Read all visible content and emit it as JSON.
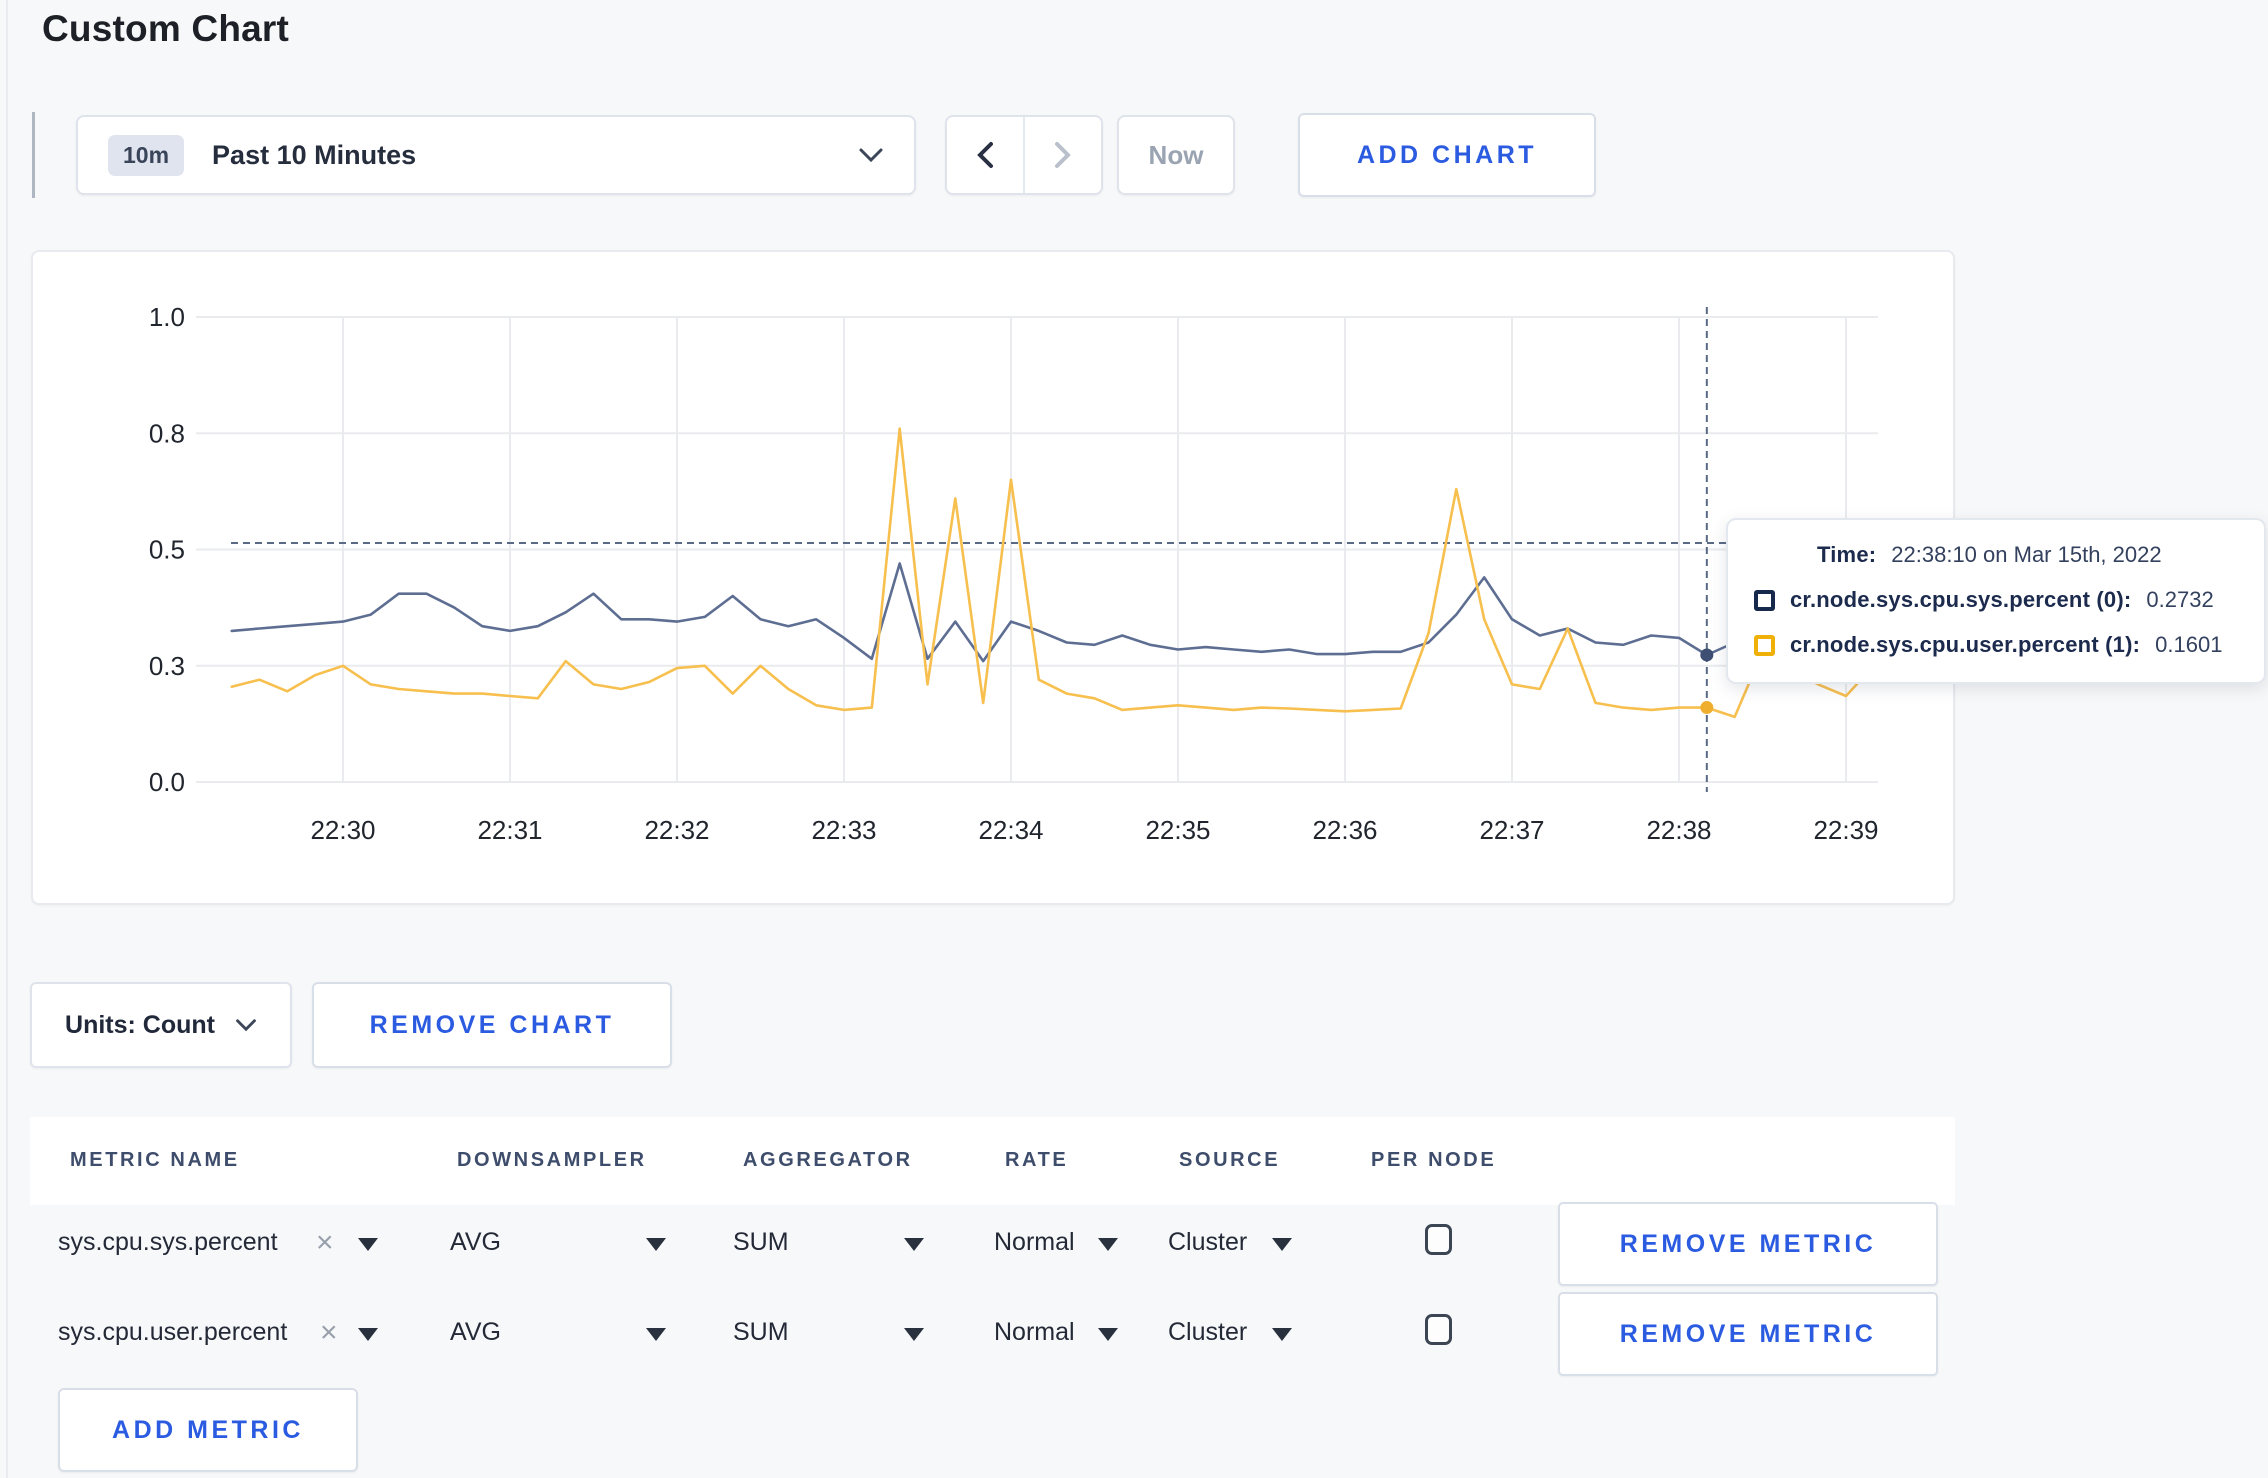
{
  "page": {
    "title": "Custom Chart"
  },
  "toolbar": {
    "time_badge": "10m",
    "time_label": "Past 10 Minutes",
    "now_label": "Now",
    "add_chart_label": "ADD CHART"
  },
  "chart_tooltip": {
    "time_label": "Time:",
    "time_value": "22:38:10 on Mar 15th, 2022",
    "series": [
      {
        "label": "cr.node.sys.cpu.sys.percent (0):",
        "value": "0.2732",
        "swatch_color": "#16294c"
      },
      {
        "label": "cr.node.sys.cpu.user.percent (1):",
        "value": "0.1601",
        "swatch_color": "#efb008"
      }
    ]
  },
  "chart_controls": {
    "units_label": "Units: Count",
    "remove_chart_label": "REMOVE CHART"
  },
  "metrics_table": {
    "headers": [
      "METRIC NAME",
      "DOWNSAMPLER",
      "AGGREGATOR",
      "RATE",
      "SOURCE",
      "PER NODE"
    ],
    "clear_icon_glyph": "×",
    "add_metric_label": "ADD METRIC",
    "rows": [
      {
        "metric": "sys.cpu.sys.percent",
        "downsampler": "AVG",
        "aggregator": "SUM",
        "rate": "Normal",
        "source": "Cluster",
        "per_node_checked": false,
        "remove_label": "REMOVE METRIC"
      },
      {
        "metric": "sys.cpu.user.percent",
        "downsampler": "AVG",
        "aggregator": "SUM",
        "rate": "Normal",
        "source": "Cluster",
        "per_node_checked": false,
        "remove_label": "REMOVE METRIC"
      }
    ]
  },
  "chart_data": {
    "type": "line",
    "title": "",
    "x_start_time": "22:29:20",
    "x_interval_seconds": 10,
    "points_per_minute": 6,
    "first_tick_index": 4,
    "x_ticks": [
      "22:30",
      "22:31",
      "22:32",
      "22:33",
      "22:34",
      "22:35",
      "22:36",
      "22:37",
      "22:38",
      "22:39"
    ],
    "y_ticks": [
      {
        "value": 0,
        "label": "0.0"
      },
      {
        "value": 0.25,
        "label": "0.3"
      },
      {
        "value": 0.5,
        "label": "0.5"
      },
      {
        "value": 0.75,
        "label": "0.8"
      },
      {
        "value": 1,
        "label": "1.0"
      }
    ],
    "ylim": [
      0,
      1
    ],
    "grid": true,
    "legend_position": "tooltip",
    "series": [
      {
        "name": "cr.node.sys.cpu.sys.percent",
        "color": "#5d6e92",
        "dot_color": "#3e4f73",
        "values": [
          0.325,
          0.33,
          0.335,
          0.34,
          0.345,
          0.36,
          0.405,
          0.405,
          0.375,
          0.335,
          0.325,
          0.335,
          0.365,
          0.405,
          0.35,
          0.35,
          0.345,
          0.355,
          0.4,
          0.35,
          0.335,
          0.35,
          0.31,
          0.265,
          0.47,
          0.265,
          0.345,
          0.26,
          0.345,
          0.325,
          0.3,
          0.295,
          0.315,
          0.295,
          0.285,
          0.29,
          0.285,
          0.28,
          0.285,
          0.275,
          0.275,
          0.28,
          0.28,
          0.3,
          0.36,
          0.44,
          0.35,
          0.315,
          0.33,
          0.3,
          0.295,
          0.315,
          0.31,
          0.2732,
          0.3,
          0.29,
          0.3,
          0.295,
          0.3,
          0.295
        ]
      },
      {
        "name": "cr.node.sys.cpu.user.percent",
        "color": "#f7bf4e",
        "dot_color": "#f0ae2f",
        "values": [
          0.205,
          0.22,
          0.195,
          0.23,
          0.25,
          0.21,
          0.2,
          0.195,
          0.19,
          0.19,
          0.185,
          0.18,
          0.26,
          0.21,
          0.2,
          0.215,
          0.245,
          0.25,
          0.19,
          0.25,
          0.2,
          0.165,
          0.155,
          0.16,
          0.76,
          0.21,
          0.61,
          0.17,
          0.65,
          0.22,
          0.19,
          0.18,
          0.155,
          0.16,
          0.165,
          0.16,
          0.155,
          0.16,
          0.158,
          0.155,
          0.152,
          0.155,
          0.158,
          0.32,
          0.63,
          0.35,
          0.21,
          0.2,
          0.33,
          0.17,
          0.16,
          0.155,
          0.16,
          0.1601,
          0.14,
          0.28,
          0.24,
          0.21,
          0.185,
          0.25
        ]
      }
    ],
    "hover": {
      "index": 53,
      "time": "22:38:10",
      "guide_value": 0.514,
      "values": [
        0.2732,
        0.1601
      ]
    }
  }
}
